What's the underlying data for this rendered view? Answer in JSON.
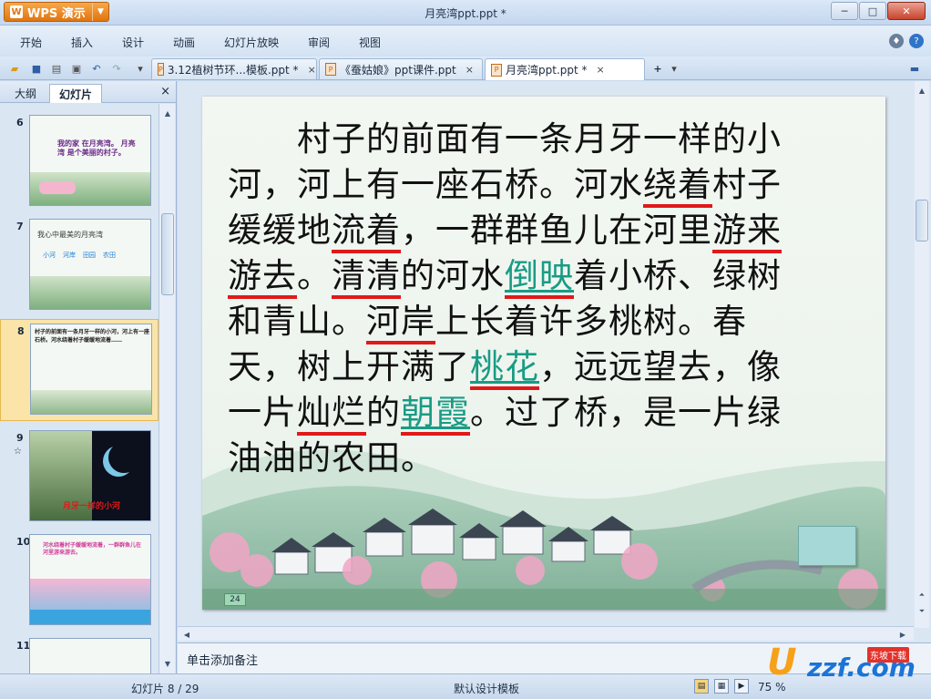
{
  "titlebar": {
    "app_button": "WPS 演示",
    "doc_title": "月亮湾ppt.ppt *",
    "minimize": "─",
    "maximize": "□",
    "close": "✕"
  },
  "menu": [
    "开始",
    "插入",
    "设计",
    "动画",
    "幻灯片放映",
    "审阅",
    "视图"
  ],
  "tabs": [
    {
      "label": "3.12植树节环...模板.ppt *",
      "close": "×"
    },
    {
      "label": "《蚕姑娘》ppt课件.ppt",
      "close": "×"
    },
    {
      "label": "月亮湾ppt.ppt *",
      "close": "×"
    }
  ],
  "left_pane": {
    "tab_outline": "大纲",
    "tab_slides": "幻灯片",
    "close": "×",
    "thumbnails": [
      {
        "number": "6",
        "text": "我的家 在月亮湾。 月亮湾 是个美丽的村子。"
      },
      {
        "number": "7",
        "text": "我心中最美的月亮湾",
        "links": [
          "小河",
          "河岸",
          "田园",
          "农田"
        ]
      },
      {
        "number": "8",
        "text": "村子的前面有一条月牙一样的小河，河上有一座石桥。河水绕着村子缓缓地流着……"
      },
      {
        "number": "9",
        "star": "☆",
        "text": "月牙一样的小河"
      },
      {
        "number": "10",
        "text": "河水绕着村子缓缓地流着，一群群鱼儿在河里游来游去。"
      },
      {
        "number": "11",
        "text": ""
      }
    ]
  },
  "slide": {
    "lines": [
      [
        {
          "t": "　　村子的前面有一条月牙一样的小"
        }
      ],
      [
        {
          "t": "河，河上有一座石桥。河水"
        },
        {
          "t": "绕着",
          "u": "red"
        },
        {
          "t": "村子"
        }
      ],
      [
        {
          "t": "缓缓地"
        },
        {
          "t": "流着",
          "u": "red"
        },
        {
          "t": "，一群群鱼儿在河里"
        },
        {
          "t": "游来",
          "u": "red"
        }
      ],
      [
        {
          "t": "游去",
          "u": "red"
        },
        {
          "t": "。"
        },
        {
          "t": "清清",
          "u": "red"
        },
        {
          "t": "的河水"
        },
        {
          "t": "倒映",
          "u": "green"
        },
        {
          "t": "着小桥、绿树"
        }
      ],
      [
        {
          "t": "和青山。"
        },
        {
          "t": "河岸",
          "u": "red"
        },
        {
          "t": "上长着许多桃树。春"
        }
      ],
      [
        {
          "t": "天，树上开满了"
        },
        {
          "t": "桃花",
          "u": "green"
        },
        {
          "t": "，远远望去，像"
        }
      ],
      [
        {
          "t": "一片"
        },
        {
          "t": "灿烂",
          "u": "red"
        },
        {
          "t": "的"
        },
        {
          "t": "朝霞",
          "u": "green"
        },
        {
          "t": "。过了桥，是一片绿"
        }
      ],
      [
        {
          "t": "油油的农田。"
        }
      ]
    ],
    "page_badge": "24"
  },
  "notes_placeholder": "单击添加备注",
  "status": {
    "slide_counter": "幻灯片 8 / 29",
    "template": "默认设计模板",
    "zoom": "75 %"
  },
  "watermark": {
    "u": "U",
    "rest": "zzf.com",
    "tag": "东坡下载"
  },
  "colors": {
    "accent_orange": "#e0750f",
    "underline_red": "#e01919",
    "link_green": "#1a9b85",
    "selection": "#fbe4a8"
  }
}
